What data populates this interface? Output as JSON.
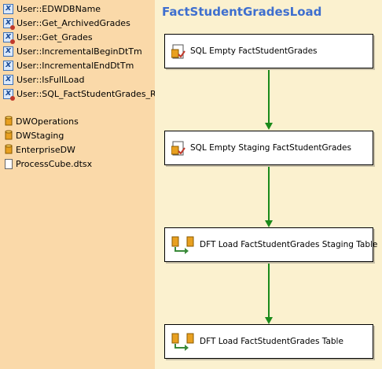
{
  "variables": [
    {
      "label": "User::EDWDBName",
      "icon": "variable-icon",
      "warn": false
    },
    {
      "label": "User::Get_ArchivedGrades",
      "icon": "variable-expression-icon",
      "warn": true
    },
    {
      "label": "User::Get_Grades",
      "icon": "variable-expression-icon",
      "warn": true
    },
    {
      "label": "User::IncrementalBeginDtTm",
      "icon": "variable-icon",
      "warn": false
    },
    {
      "label": "User::IncrementalEndDtTm",
      "icon": "variable-icon",
      "warn": false
    },
    {
      "label": "User::IsFullLoad",
      "icon": "variable-icon",
      "warn": false
    },
    {
      "label": "User::SQL_FactStudentGrades_Re",
      "icon": "variable-expression-icon",
      "warn": true
    }
  ],
  "connections": [
    {
      "label": "DWOperations",
      "icon": "database-icon"
    },
    {
      "label": "DWStaging",
      "icon": "database-icon"
    },
    {
      "label": "EnterpriseDW",
      "icon": "database-icon"
    },
    {
      "label": "ProcessCube.dtsx",
      "icon": "file-icon"
    }
  ],
  "package_title": "FactStudentGradesLoad",
  "tasks": [
    {
      "label": "SQL Empty FactStudentGrades",
      "icon": "sql-task-icon"
    },
    {
      "label": "SQL Empty Staging FactStudentGrades",
      "icon": "sql-task-icon"
    },
    {
      "label": "DFT Load FactStudentGrades Staging Table",
      "icon": "data-flow-task-icon"
    },
    {
      "label": "DFT Load FactStudentGrades Table",
      "icon": "data-flow-task-icon"
    }
  ],
  "colors": {
    "left_panel": "#fad9a9",
    "canvas": "#fbf1cf",
    "title": "#3e6fcf",
    "connector": "#1a8a1a"
  }
}
